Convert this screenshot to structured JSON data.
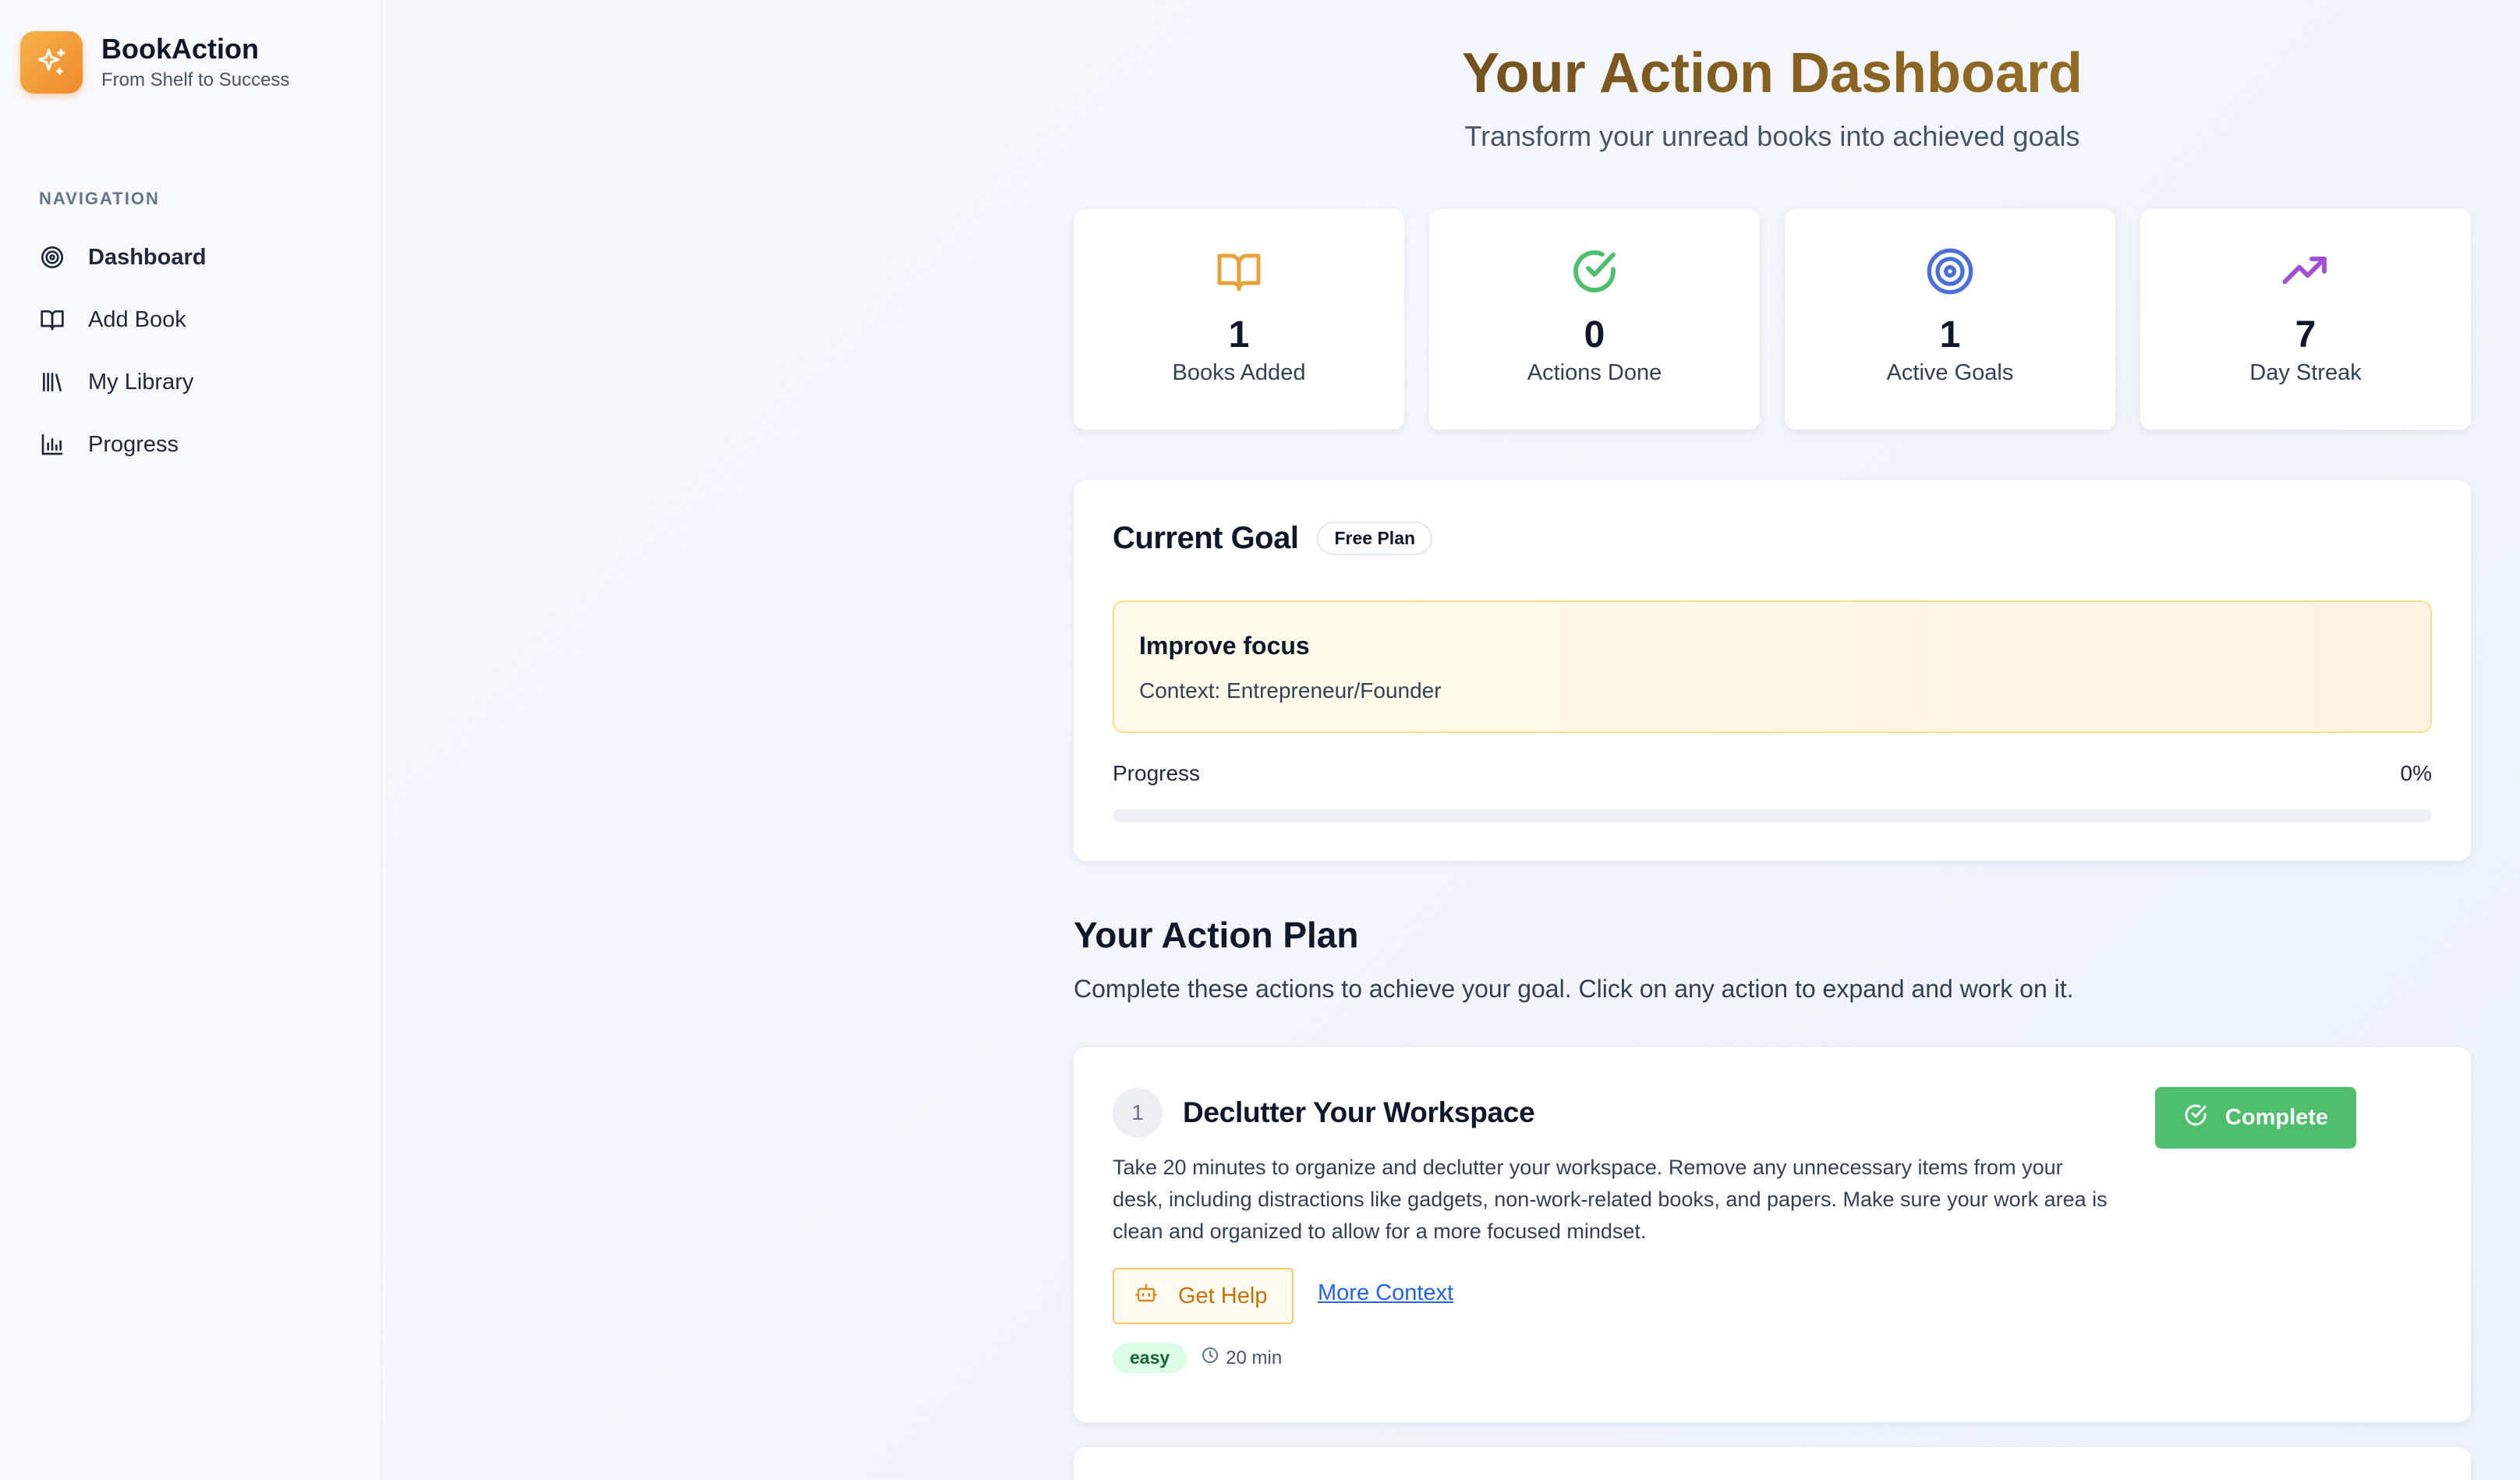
{
  "brand": {
    "title": "BookAction",
    "subtitle": "From Shelf to Success",
    "logo_icon": "sparkles-icon",
    "accent": "#f0952f"
  },
  "sidebar": {
    "heading": "NAVIGATION",
    "items": [
      {
        "label": "Dashboard",
        "icon": "target-icon",
        "active": true
      },
      {
        "label": "Add Book",
        "icon": "book-open-icon"
      },
      {
        "label": "My Library",
        "icon": "library-icon"
      },
      {
        "label": "Progress",
        "icon": "bar-chart-icon"
      }
    ]
  },
  "header": {
    "title": "Your Action Dashboard",
    "subtitle": "Transform your unread books into achieved goals"
  },
  "stats": [
    {
      "value": "1",
      "label": "Books Added",
      "icon": "book-open-icon",
      "color": "#e8a13a"
    },
    {
      "value": "0",
      "label": "Actions Done",
      "icon": "check-circle-icon",
      "color": "#4fbf6d"
    },
    {
      "value": "1",
      "label": "Active Goals",
      "icon": "target-icon",
      "color": "#4a6fd8"
    },
    {
      "value": "7",
      "label": "Day Streak",
      "icon": "trending-up-icon",
      "color": "#a24fd6"
    }
  ],
  "goal": {
    "heading": "Current Goal",
    "plan_badge": "Free Plan",
    "title": "Improve focus",
    "context": "Context: Entrepreneur/Founder",
    "progress_label": "Progress",
    "progress_text": "0%",
    "progress_fraction": 0
  },
  "action_plan": {
    "title": "Your Action Plan",
    "description": "Complete these actions to achieve your goal. Click on any action to expand and work on it.",
    "actions": [
      {
        "number": "1",
        "title": "Declutter Your Workspace",
        "description": "Take 20 minutes to organize and declutter your workspace. Remove any unnecessary items from your desk, including distractions like gadgets, non-work-related books, and papers. Make sure your work area is clean and organized to allow for a more focused mindset.",
        "complete_label": "Complete",
        "help_label": "Get Help",
        "context_link": "More Context",
        "difficulty": "easy",
        "duration": "20 min"
      }
    ]
  }
}
